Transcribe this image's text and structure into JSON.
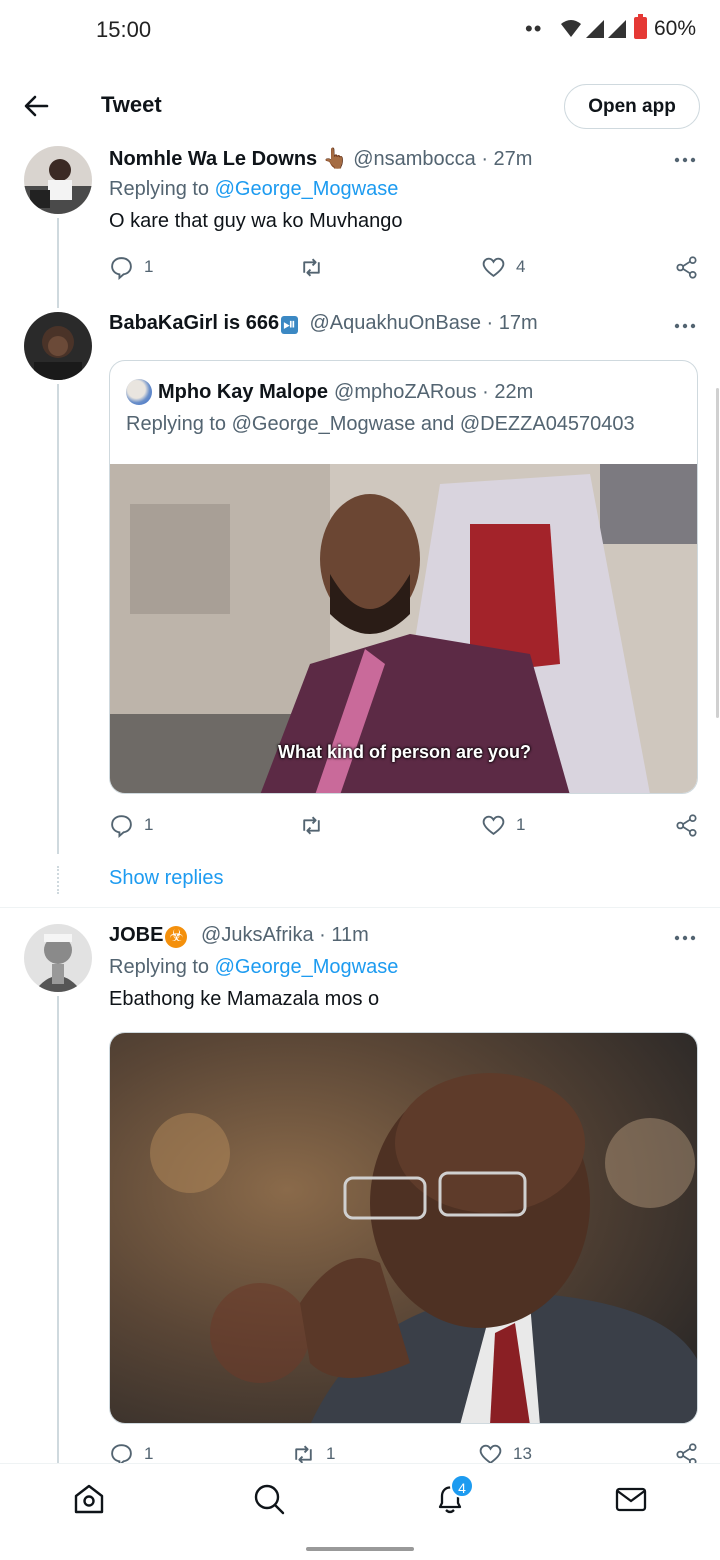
{
  "status_bar": {
    "time": "15:00",
    "dots": "••",
    "battery": "60%"
  },
  "header": {
    "back_icon": "arrow-left-icon",
    "title": "Tweet",
    "open_app_label": "Open app"
  },
  "tweets": [
    {
      "name": "Nomhle Wa Le Downs",
      "emoji": "👆🏾",
      "handle": "@nsambocca · 27m",
      "replying_prefix": "Replying to ",
      "replying_to": "@George_Mogwase",
      "text": "O kare that guy wa ko Muvhango",
      "replies": "1",
      "retweets": "",
      "likes": "4"
    },
    {
      "name": "BabaKaGirl is 666",
      "emoji": "⏯",
      "handle": "@AquakhuOnBase · 17m",
      "quote": {
        "name": "Mpho Kay Malope",
        "handle": "@mphoZARous · 22m",
        "replying": "Replying to @George_Mogwase and @DEZZA04570403",
        "caption": "What kind of person are you?"
      },
      "replies": "1",
      "retweets": "",
      "likes": "1",
      "show_replies": "Show replies"
    },
    {
      "name": "JOBE",
      "emoji": "☣",
      "handle": "@JuksAfrika · 11m",
      "replying_prefix": "Replying to ",
      "replying_to": "@George_Mogwase",
      "text": "Ebathong ke Mamazala mos o",
      "replies": "1",
      "retweets": "1",
      "likes": "13"
    }
  ],
  "bottom_nav": {
    "items": [
      "home-icon",
      "search-icon",
      "bell-icon",
      "mail-icon"
    ],
    "notification_count": "4"
  },
  "colors": {
    "accent": "#1d9bf0",
    "text": "#0f1419",
    "secondary": "#536471"
  }
}
